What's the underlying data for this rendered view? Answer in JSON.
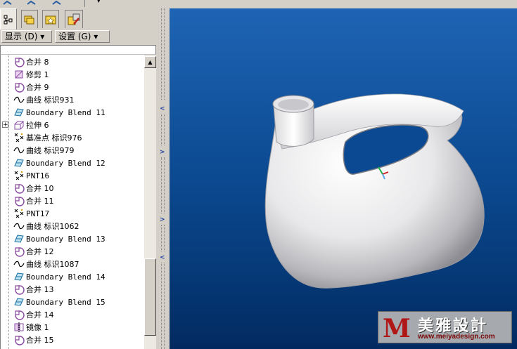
{
  "menus": {
    "display": "显示 (D) ▾",
    "settings": "设置 (G) ▾"
  },
  "tree": {
    "items": [
      {
        "label": "合并 8",
        "icon": "merge-icon"
      },
      {
        "label": "修剪 1",
        "icon": "trim-icon"
      },
      {
        "label": "合并 9",
        "icon": "merge-icon"
      },
      {
        "label": "曲线 标识931",
        "icon": "curve-icon"
      },
      {
        "label": "Boundary Blend 11",
        "icon": "boundary-blend-icon"
      },
      {
        "label": "拉伸 6",
        "icon": "extrude-icon"
      },
      {
        "label": "基准点 标识976",
        "icon": "datum-point-icon"
      },
      {
        "label": "曲线 标识979",
        "icon": "curve-icon"
      },
      {
        "label": "Boundary Blend 12",
        "icon": "boundary-blend-icon"
      },
      {
        "label": "PNT16",
        "icon": "datum-point-icon"
      },
      {
        "label": "合并 10",
        "icon": "merge-icon"
      },
      {
        "label": "合并 11",
        "icon": "merge-icon"
      },
      {
        "label": "PNT17",
        "icon": "datum-point-icon"
      },
      {
        "label": "曲线 标识1062",
        "icon": "curve-icon"
      },
      {
        "label": "Boundary Blend 13",
        "icon": "boundary-blend-icon"
      },
      {
        "label": "合并 12",
        "icon": "merge-icon"
      },
      {
        "label": "曲线 标识1087",
        "icon": "curve-icon"
      },
      {
        "label": "Boundary Blend 14",
        "icon": "boundary-blend-icon"
      },
      {
        "label": "合并 13",
        "icon": "merge-icon"
      },
      {
        "label": "Boundary Blend 15",
        "icon": "boundary-blend-icon"
      },
      {
        "label": "合并 14",
        "icon": "merge-icon"
      },
      {
        "label": "镜像 1",
        "icon": "mirror-icon"
      },
      {
        "label": "合并 15",
        "icon": "merge-icon"
      }
    ]
  },
  "watermark": {
    "title": "美雅設計",
    "url": "www.meiyadesign.com",
    "logo_letter": "M"
  },
  "colors": {
    "viewport_top": "#1e64b4",
    "viewport_bottom": "#022a60",
    "feature_icon": "#8a4aa0"
  }
}
